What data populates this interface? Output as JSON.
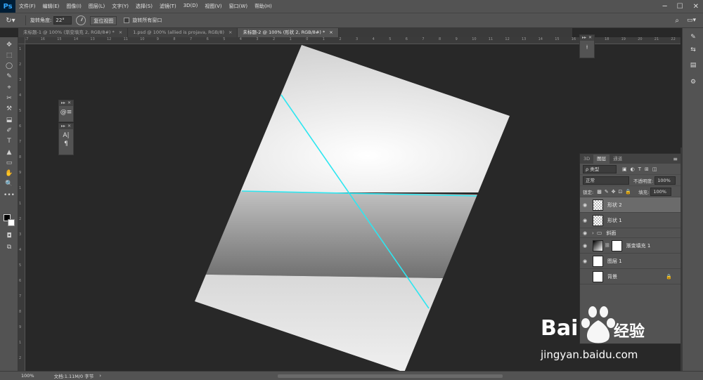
{
  "app": {
    "logo": "Ps"
  },
  "menu": [
    "文件(F)",
    "编辑(E)",
    "图像(I)",
    "图层(L)",
    "文字(Y)",
    "选择(S)",
    "滤镜(T)",
    "3D(D)",
    "视图(V)",
    "窗口(W)",
    "帮助(H)"
  ],
  "options": {
    "rotate_label": "旋转角度:",
    "rotate_value": "22°",
    "reset_view": "复位视图",
    "rotate_all": "旋转所有窗口"
  },
  "tabs": [
    {
      "label": "未标题-1 @ 100% (渐变填充 2, RGB/8#) *",
      "close": "×"
    },
    {
      "label": "1.psd @ 100% (allied is projava, RGB/8)",
      "close": "×"
    },
    {
      "label": "未标题-2 @ 100% (形状 2, RGB/8#) *",
      "close": "×"
    }
  ],
  "ruler_top": [
    "17",
    "16",
    "15",
    "14",
    "13",
    "12",
    "11",
    "10",
    "9",
    "8",
    "7",
    "6",
    "5",
    "4",
    "3",
    "2",
    "1",
    "0",
    "1",
    "2",
    "3",
    "4",
    "5",
    "6",
    "7",
    "8",
    "9",
    "10",
    "11",
    "12",
    "13",
    "14",
    "15",
    "16",
    "17",
    "18",
    "19",
    "20",
    "21",
    "22"
  ],
  "ruler_left": [
    "1",
    "2",
    "3",
    "4",
    "5",
    "6",
    "7",
    "8",
    "9",
    "1",
    "1",
    "2",
    "3",
    "4",
    "5",
    "6",
    "7",
    "8",
    "9",
    "1",
    "2"
  ],
  "tools": [
    "✥",
    "⬚",
    "◯",
    "✎",
    "⌖",
    "✂",
    "⚒",
    "⬓",
    "✐",
    "T",
    "▲",
    "▭",
    "✋",
    "🔍",
    "•••"
  ],
  "float_panel": {
    "char_icon": "A|",
    "para_icon": "¶"
  },
  "layers_panel": {
    "tabs": [
      "3D",
      "图层",
      "通道"
    ],
    "filter_kind": "ρ 类型",
    "blend_mode": "正常",
    "opacity_label": "不透明度:",
    "opacity_value": "100%",
    "lock_label": "锁定:",
    "fill_label": "填充:",
    "fill_value": "100%",
    "layers": [
      {
        "name": "形状 2",
        "type": "shape",
        "active": true
      },
      {
        "name": "形状 1",
        "type": "shape",
        "active": false
      },
      {
        "name": "斜面",
        "type": "group",
        "active": false
      },
      {
        "name": "渐变填充 1",
        "type": "gradient",
        "active": false
      },
      {
        "name": "图层 1",
        "type": "pixel",
        "active": false
      },
      {
        "name": "背景",
        "type": "background",
        "active": false
      }
    ]
  },
  "status": {
    "zoom": "100%",
    "doc_info": "文档:1.11M/0 字节"
  },
  "watermark": {
    "brand": "Bai",
    "brand2": "经验",
    "url": "jingyan.baidu.com"
  }
}
